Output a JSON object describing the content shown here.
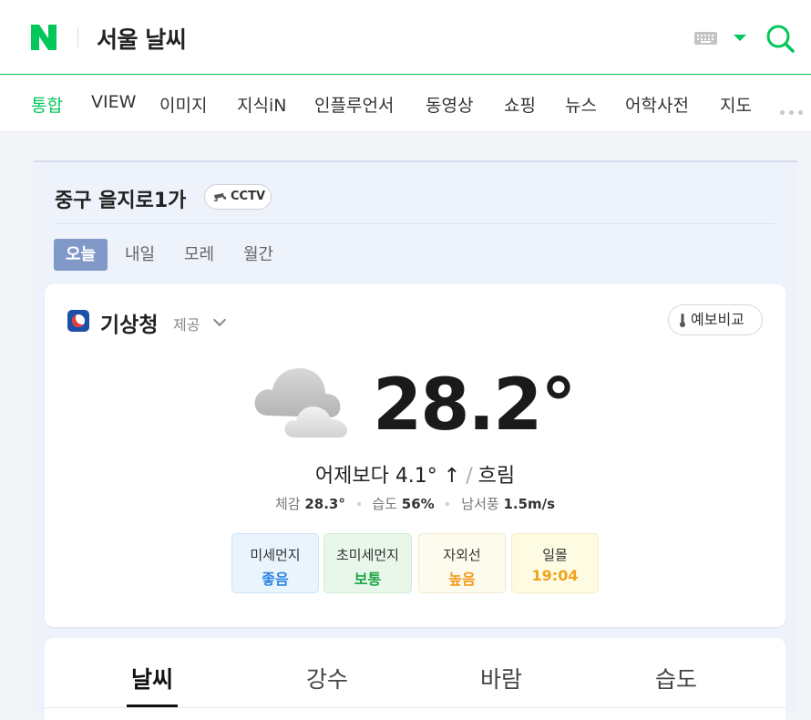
{
  "header": {
    "logo": "N",
    "title": "서울 날씨",
    "icons": [
      "keyboard-icon",
      "caret-down-icon",
      "search-icon"
    ],
    "brand_color": "#03c75a"
  },
  "nav": {
    "items": [
      "통합",
      "VIEW",
      "이미지",
      "지식iN",
      "인플루언서",
      "동영상",
      "쇼핑",
      "뉴스",
      "어학사전",
      "지도"
    ],
    "active": "통합"
  },
  "location": {
    "name": "중구 을지로1가",
    "cctv_label": "CCTV"
  },
  "day_tabs": {
    "items": [
      "오늘",
      "내일",
      "모레",
      "월간"
    ],
    "active": "오늘"
  },
  "current": {
    "provider": "기상청",
    "provider_sub": "제공",
    "compare_label": "예보비교",
    "temperature": "28.2°",
    "compare_yesterday": "어제보다 4.1° ↑",
    "condition": "흐림",
    "feels_label": "체감",
    "feels_value": "28.3°",
    "humidity_label": "습도",
    "humidity_value": "56%",
    "wind_label": "남서풍",
    "wind_value": "1.5m/s"
  },
  "indicators": [
    {
      "title": "미세먼지",
      "value": "좋음",
      "color": "#2f85e3",
      "bg": "#e9f4fd"
    },
    {
      "title": "초미세먼지",
      "value": "보통",
      "color": "#1ba644",
      "bg": "#e8f7ea"
    },
    {
      "title": "자외선",
      "value": "높음",
      "color": "#f39a1a",
      "bg": "#fdfaee"
    },
    {
      "title": "일몰",
      "value": "19:04",
      "color": "#f0a31b",
      "bg": "#fefbe3"
    }
  ],
  "bottom_tabs": {
    "items": [
      "날씨",
      "강수",
      "바람",
      "습도"
    ],
    "active": "날씨"
  }
}
